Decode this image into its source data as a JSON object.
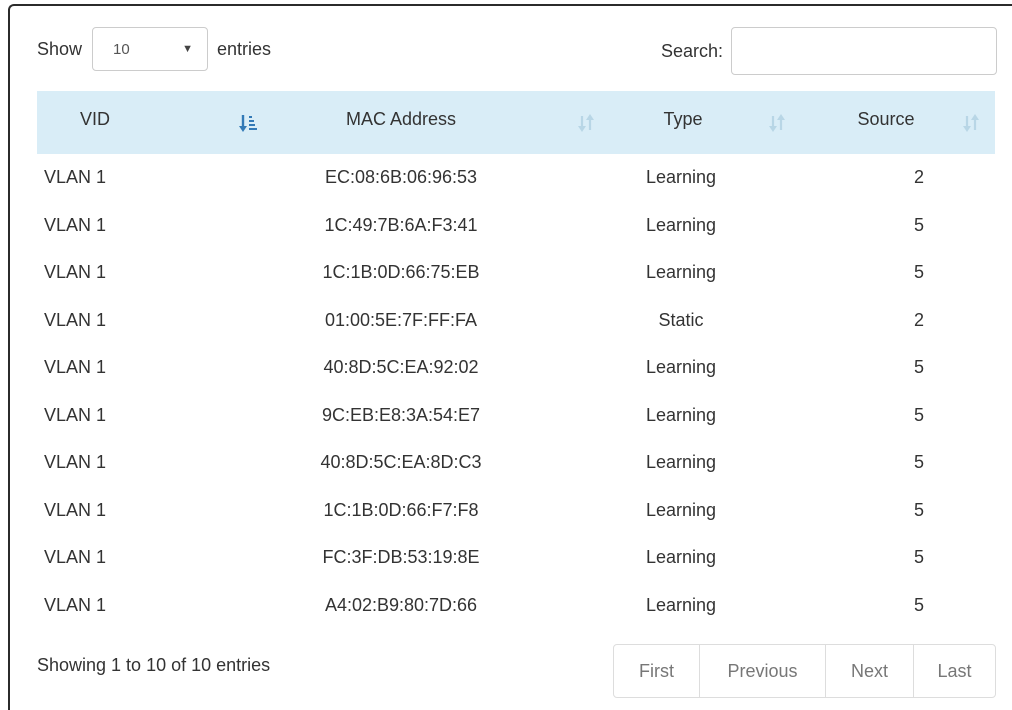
{
  "length_menu": {
    "prefix": "Show",
    "selected": "10",
    "suffix": "entries"
  },
  "search": {
    "label": "Search:",
    "value": ""
  },
  "table": {
    "columns": [
      {
        "label": "VID",
        "sort": "ascending"
      },
      {
        "label": "MAC Address",
        "sort": "none"
      },
      {
        "label": "Type",
        "sort": "none"
      },
      {
        "label": "Source",
        "sort": "none"
      }
    ],
    "rows": [
      [
        "VLAN 1",
        "EC:08:6B:06:96:53",
        "Learning",
        "2"
      ],
      [
        "VLAN 1",
        "1C:49:7B:6A:F3:41",
        "Learning",
        "5"
      ],
      [
        "VLAN 1",
        "1C:1B:0D:66:75:EB",
        "Learning",
        "5"
      ],
      [
        "VLAN 1",
        "01:00:5E:7F:FF:FA",
        "Static",
        "2"
      ],
      [
        "VLAN 1",
        "40:8D:5C:EA:92:02",
        "Learning",
        "5"
      ],
      [
        "VLAN 1",
        "9C:EB:E8:3A:54:E7",
        "Learning",
        "5"
      ],
      [
        "VLAN 1",
        "40:8D:5C:EA:8D:C3",
        "Learning",
        "5"
      ],
      [
        "VLAN 1",
        "1C:1B:0D:66:F7:F8",
        "Learning",
        "5"
      ],
      [
        "VLAN 1",
        "FC:3F:DB:53:19:8E",
        "Learning",
        "5"
      ],
      [
        "VLAN 1",
        "A4:02:B9:80:7D:66",
        "Learning",
        "5"
      ]
    ]
  },
  "footer": {
    "info": "Showing 1 to 10 of 10 entries",
    "pagination": [
      "First",
      "Previous",
      "Next",
      "Last"
    ]
  },
  "colors": {
    "header_bg": "#d9edf7",
    "sort_active": "#337ab7",
    "sort_inactive": "#b8d6e6",
    "pagination_text": "#777777"
  }
}
